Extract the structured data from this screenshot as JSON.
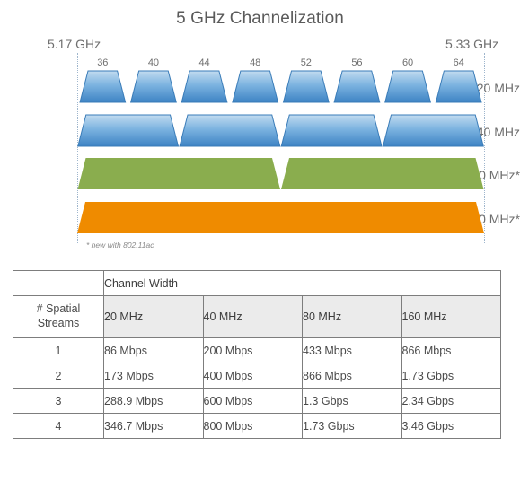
{
  "chart": {
    "title": "5 GHz Channelization",
    "freq_left": "5.17 GHz",
    "freq_right": "5.33 GHz",
    "footnote": "* new with 802.11ac",
    "channels": [
      "36",
      "40",
      "44",
      "48",
      "52",
      "56",
      "60",
      "64"
    ],
    "rows": [
      {
        "label": "20 MHz",
        "segments": 8,
        "color": "#5a9bd5"
      },
      {
        "label": "40 MHz",
        "segments": 4,
        "color": "#5a9bd5"
      },
      {
        "label": "80 MHz*",
        "segments": 2,
        "color": "#8aad4e"
      },
      {
        "label": "160 MHz*",
        "segments": 1,
        "color": "#ef8b00"
      }
    ],
    "colors": {
      "blue_top": "#b8d4ee",
      "blue_bottom": "#3f85c6",
      "blue_stroke": "#3a7cb8",
      "green": "#8aad4e",
      "orange": "#ef8b00",
      "guide": "#9fb6cd",
      "text": "#6e6e6e"
    }
  },
  "chart_data": {
    "type": "bar",
    "title": "5 GHz Channelization",
    "xlabel": "",
    "ylabel": "Channel Width",
    "x_axis_range": [
      "5.17 GHz",
      "5.33 GHz"
    ],
    "categories": [
      "20 MHz",
      "40 MHz",
      "80 MHz*",
      "160 MHz*"
    ],
    "values": [
      8,
      4,
      2,
      1
    ],
    "channel_numbers": [
      36,
      40,
      44,
      48,
      52,
      56,
      60,
      64
    ],
    "annotations": [
      "* new with 802.11ac"
    ],
    "grid": false,
    "legend": "none"
  },
  "table": {
    "group_header": "Channel Width",
    "row_header": "# Spatial\nStreams",
    "row_header_line1": "# Spatial",
    "row_header_line2": "Streams",
    "columns": [
      "20 MHz",
      "40 MHz",
      "80 MHz",
      "160 MHz"
    ],
    "rows": [
      {
        "streams": "1",
        "cells": [
          "86 Mbps",
          "200 Mbps",
          "433 Mbps",
          "866 Mbps"
        ]
      },
      {
        "streams": "2",
        "cells": [
          "173 Mbps",
          "400 Mbps",
          "866 Mbps",
          "1.73 Gbps"
        ]
      },
      {
        "streams": "3",
        "cells": [
          "288.9 Mbps",
          "600 Mbps",
          "1.3 Gbps",
          "2.34 Gbps"
        ]
      },
      {
        "streams": "4",
        "cells": [
          "346.7 Mbps",
          "800 Mbps",
          "1.73 Gbps",
          "3.46 Gbps"
        ]
      }
    ]
  }
}
